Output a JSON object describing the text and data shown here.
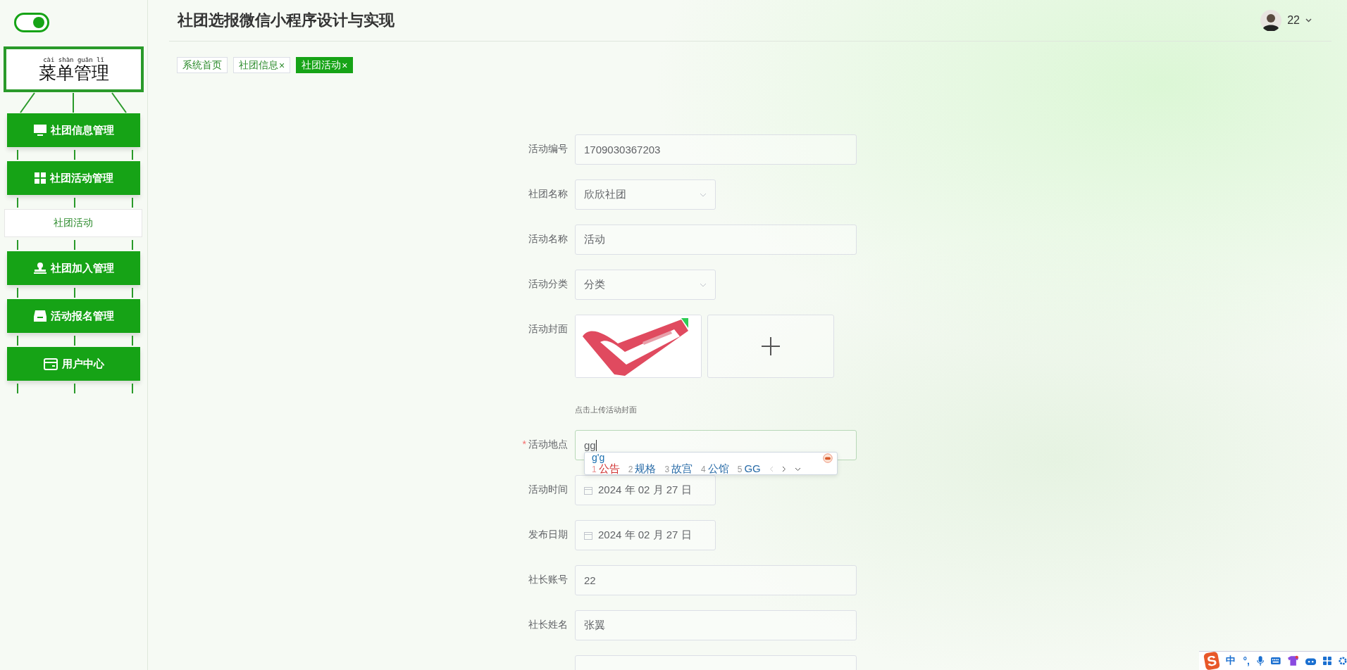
{
  "sidebar": {
    "toggle": {
      "on": true
    },
    "menu_title": {
      "pinyin": "cài shàn guǎn lǐ",
      "text": "菜单管理"
    },
    "items": [
      {
        "label": "社团信息管理",
        "kind": "group",
        "selected": false
      },
      {
        "label": "社团活动管理",
        "kind": "group",
        "selected": false
      },
      {
        "label": "社团活动",
        "kind": "sub",
        "selected": true
      },
      {
        "label": "社团加入管理",
        "kind": "group",
        "selected": false
      },
      {
        "label": "活动报名管理",
        "kind": "group",
        "selected": false
      },
      {
        "label": "用户中心",
        "kind": "group",
        "selected": false
      }
    ]
  },
  "header": {
    "title": "社团选报微信小程序设计与实现",
    "user": {
      "name": "22"
    }
  },
  "tabs": [
    {
      "label": "系统首页",
      "selected": false
    },
    {
      "label": "社团信息",
      "close": "×",
      "selected": false
    },
    {
      "label": "社团活动",
      "close": "×",
      "selected": true
    }
  ],
  "form": {
    "fields": [
      {
        "label": "活动编号",
        "kind": "text",
        "value": "1709030367203"
      },
      {
        "label": "社团名称",
        "kind": "select",
        "value": "欣欣社团"
      },
      {
        "label": "活动名称",
        "kind": "text",
        "value": "活动"
      },
      {
        "label": "活动分类",
        "kind": "select",
        "value": "分类"
      },
      {
        "label": "活动封面",
        "kind": "upload",
        "hint": "点击上传活动封面"
      },
      {
        "label": "活动地点",
        "kind": "text",
        "value": "gg",
        "required_mark": "*",
        "focused": true
      },
      {
        "label": "活动时间",
        "kind": "date",
        "value": "2024 年 02 月 27 日"
      },
      {
        "label": "发布日期",
        "kind": "date",
        "value": "2024 年 02 月 27 日"
      },
      {
        "label": "社长账号",
        "kind": "text",
        "value": "22"
      },
      {
        "label": "社长姓名",
        "kind": "text",
        "value": "张翼"
      },
      {
        "kind": "text"
      }
    ]
  },
  "ime": {
    "composition": "g'g",
    "candidates": [
      {
        "index": "1",
        "text": "公告",
        "selected": true
      },
      {
        "index": "2",
        "text": "规格",
        "selected": false
      },
      {
        "index": "3",
        "text": "故宫",
        "selected": false
      },
      {
        "index": "4",
        "text": "公馆",
        "selected": false
      },
      {
        "index": "5",
        "text": "GG",
        "selected": false
      }
    ],
    "toolbar": {
      "logo": "S",
      "mode": "中",
      "punct": "°,"
    }
  }
}
